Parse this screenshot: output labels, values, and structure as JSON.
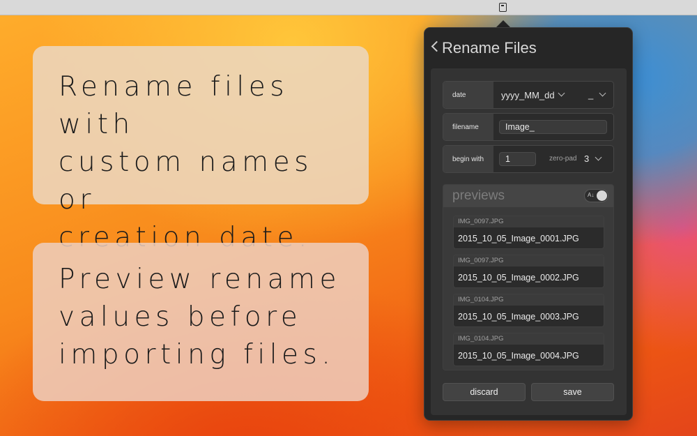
{
  "menubar": {
    "icon": "clipboard-icon"
  },
  "promos": [
    {
      "lines": [
        "Rename files with",
        "custom names or",
        "creation date."
      ]
    },
    {
      "lines": [
        "Preview rename",
        "values before",
        "importing files."
      ]
    }
  ],
  "popover": {
    "title": "Rename Files",
    "date": {
      "label": "date",
      "format": "yyyy_MM_dd",
      "separator": "_"
    },
    "filename": {
      "label": "filename",
      "value": "Image_"
    },
    "begin": {
      "label": "begin with",
      "value": "1",
      "zero_pad_label": "zero-pad",
      "zero_pad_value": "3"
    },
    "previews": {
      "title": "previews",
      "toggle_label": "A↓",
      "toggle_on": true,
      "items": [
        {
          "original": "IMG_0097.JPG",
          "renamed": "2015_10_05_Image_0001.JPG"
        },
        {
          "original": "IMG_0097.JPG",
          "renamed": "2015_10_05_Image_0002.JPG"
        },
        {
          "original": "IMG_0104.JPG",
          "renamed": "2015_10_05_Image_0003.JPG"
        },
        {
          "original": "IMG_0104.JPG",
          "renamed": "2015_10_05_Image_0004.JPG"
        }
      ]
    },
    "discard_label": "discard",
    "save_label": "save"
  },
  "colors": {
    "panel": "#262626",
    "accent_orange": "#f88a1c",
    "accent_blue": "#3b8ed6"
  }
}
